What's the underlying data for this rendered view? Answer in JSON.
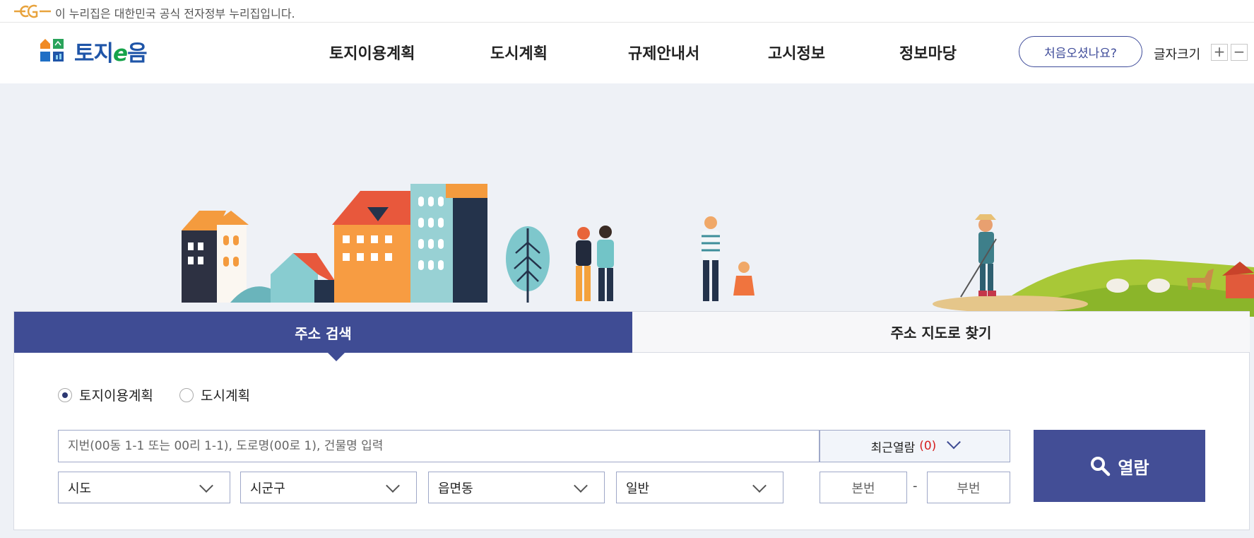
{
  "gov_bar": {
    "text": "이 누리집은 대한민국 공식 전자정부 누리집입니다."
  },
  "header": {
    "logo_text_a": "토지",
    "logo_text_e": "e",
    "logo_text_b": "음",
    "nav": [
      "토지이용계획",
      "도시계획",
      "규제안내서",
      "고시정보",
      "정보마당"
    ],
    "first_visit": "처음오셨나요?",
    "font_size_label": "글자크기",
    "font_plus": "+",
    "font_minus": "−"
  },
  "search": {
    "tabs": [
      "주소 검색",
      "주소 지도로 찾기"
    ],
    "radios": [
      "토지이용계획",
      "도시계획"
    ],
    "selected_radio": "토지이용계획",
    "placeholder": "지번(00동 1-1 또는 00리 1-1), 도로명(00로 1), 건물명 입력",
    "recent_label": "최근열람",
    "recent_count": "(0)",
    "selects": [
      "시도",
      "시군구",
      "읍면동",
      "일반"
    ],
    "main_no": "본번",
    "dash": "-",
    "sub_no": "부번",
    "open_label": "열람"
  },
  "colors": {
    "primary": "#3f4c94",
    "accent_red": "#d62020",
    "logo_blue": "#1f55a8",
    "logo_green": "#16a34a"
  }
}
